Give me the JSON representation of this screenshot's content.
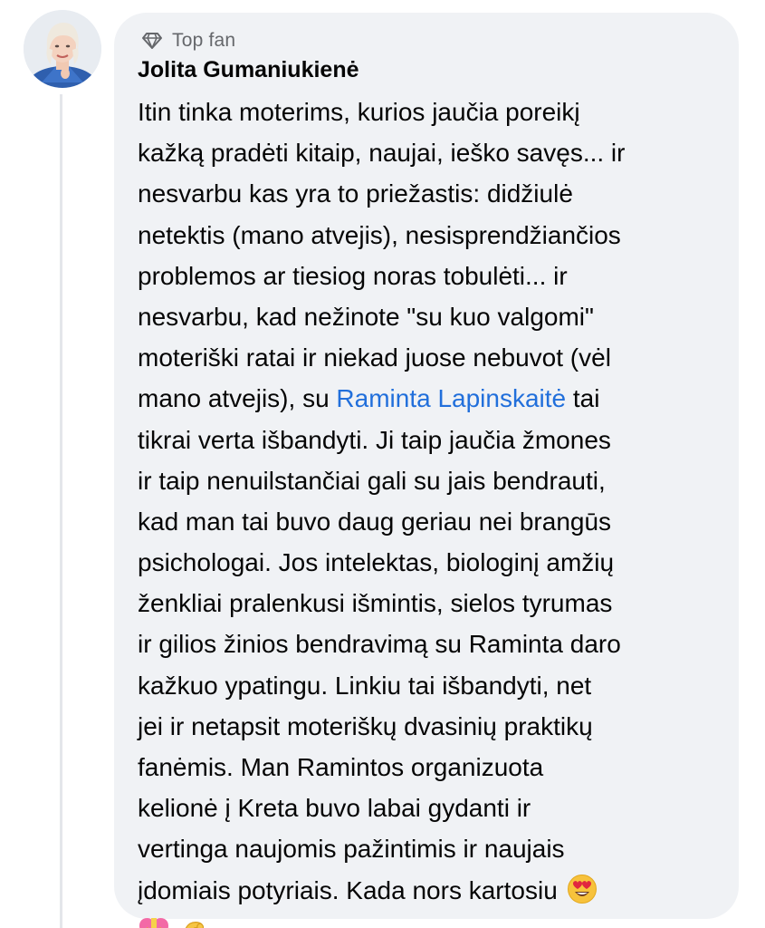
{
  "comment": {
    "badge": {
      "icon": "diamond-icon",
      "label": "Top fan"
    },
    "author": {
      "name": "Jolita Gumaniukienė",
      "avatar": "avatar"
    },
    "lines": [
      "Itin tinka moterims, kurios jaučia poreikį",
      "kažką pradėti kitaip, naujai, ieško savęs... ir",
      "nesvarbu kas yra to priežastis: didžiulė",
      "netektis (mano atvejis), nesisprendžiančios",
      "problemos ar tiesiog noras tobulėti... ir",
      "nesvarbu, kad nežinote \"su kuo valgomi\"",
      "moteriški ratai ir niekad juose nebuvot (vėl",
      "mano atvejis), su ",
      "tikrai verta išbandyti. Ji taip jaučia žmones",
      "ir taip nenuilstančiai gali su jais bendrauti,",
      "kad man tai buvo daug geriau nei brangūs",
      "psichologai. Jos intelektas, biologinį amžių",
      "ženkliai pralenkusi išmintis, sielos tyrumas",
      "ir gilios žinios bendravimą su Raminta daro",
      "kažkuo ypatingu. Linkiu tai išbandyti, net",
      "jei ir netapsit moteriškų dvasinių praktikų",
      "fanėmis. Man Ramintos organizuota",
      "kelionė į Kreta buvo labai gydanti ir",
      "vertinga naujomis pažintimis ir naujais",
      "įdomiais potyriais. Kada nors kartosiu "
    ],
    "mention": "Raminta Lapinskaitė",
    "after_mention": " tai",
    "emojis": {
      "inline": "heart-eyes-emoji",
      "trailing": [
        "heart-with-ribbon-emoji",
        "pinching-hand-emoji"
      ]
    },
    "colors": {
      "bubble": "#f0f2f5",
      "mention": "#216fdb",
      "badge_text": "#65676b",
      "text": "#050505"
    }
  }
}
